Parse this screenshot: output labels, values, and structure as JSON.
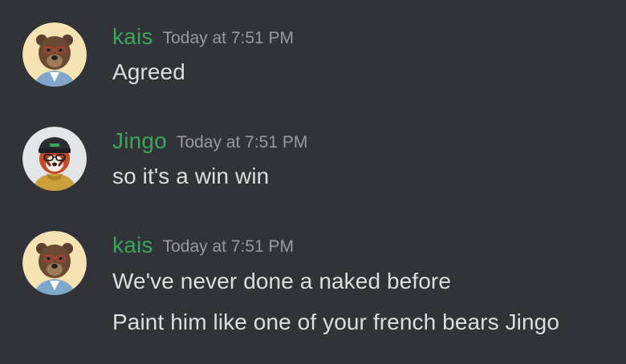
{
  "colors": {
    "background": "#313338",
    "username": "#3ba55c",
    "timestamp": "#949ba4",
    "message_text": "#dbdee1"
  },
  "messages": [
    {
      "author": "kais",
      "timestamp": "Today at 7:51 PM",
      "avatar_icon": "bear-avatar-icon",
      "lines": [
        "Agreed"
      ]
    },
    {
      "author": "Jingo",
      "timestamp": "Today at 7:51 PM",
      "avatar_icon": "red-panda-avatar-icon",
      "lines": [
        "so it's a win win"
      ]
    },
    {
      "author": "kais",
      "timestamp": "Today at 7:51 PM",
      "avatar_icon": "bear-avatar-icon",
      "lines": [
        "We've never done a naked before",
        "Paint him like one of your french bears Jingo"
      ]
    }
  ]
}
